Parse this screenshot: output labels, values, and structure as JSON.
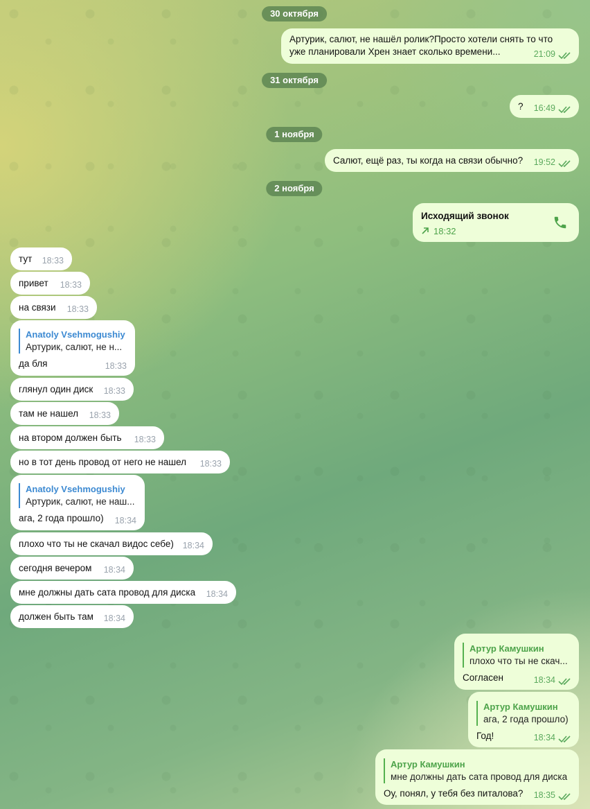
{
  "colors": {
    "incoming_bubble": "#ffffff",
    "outgoing_bubble": "#eefed9",
    "accent_green": "#4da34a",
    "reply_blue": "#3d8ad2",
    "date_pill": "#5c8452"
  },
  "dates": [
    "30 октября",
    "31 октября",
    "1 ноября",
    "2 ноября"
  ],
  "out_messages": [
    {
      "line1": "Артурик, салют, не нашёл ролик?Просто хотели снять то что",
      "line2": "уже планировали Хрен знает сколько времени...",
      "time": "21:09"
    },
    {
      "text": "?",
      "time": "16:49"
    },
    {
      "text": "Салют, ещё раз, ты когда на связи обычно?",
      "time": "19:52"
    }
  ],
  "call": {
    "title": "Исходящий звонок",
    "time": "18:32",
    "icon": "phone-icon",
    "arrow": "outgoing-arrow-icon"
  },
  "in_messages": [
    {
      "text": "тут",
      "time": "18:33"
    },
    {
      "text": "привет",
      "time": "18:33"
    },
    {
      "text": "на связи",
      "time": "18:33"
    },
    {
      "reply_name": "Anatoly Vsehmogushiy",
      "reply_text": "Артурик, салют, не н...",
      "text": "да бля",
      "time": "18:33"
    },
    {
      "text": "глянул один диск",
      "time": "18:33"
    },
    {
      "text": "там не нашел",
      "time": "18:33"
    },
    {
      "text": "на втором должен быть",
      "time": "18:33"
    },
    {
      "text": "но в тот день провод от него не нашел",
      "time": "18:33"
    },
    {
      "reply_name": "Anatoly Vsehmogushiy",
      "reply_text": "Артурик, салют, не наш...",
      "text": "ага, 2 года прошло)",
      "time": "18:34"
    },
    {
      "text": "плохо что ты не скачал видос себе)",
      "time": "18:34"
    },
    {
      "text": "сегодня вечером",
      "time": "18:34"
    },
    {
      "text": "мне должны дать сата провод для диска",
      "time": "18:34"
    },
    {
      "text": "должен быть там",
      "time": "18:34"
    }
  ],
  "out_replies": [
    {
      "reply_name": "Артур Камушкин",
      "reply_text": "плохо что ты не скач...",
      "text": "Согласен",
      "time": "18:34"
    },
    {
      "reply_name": "Артур Камушкин",
      "reply_text": "ага, 2 года прошло)",
      "text": "Год!",
      "time": "18:34"
    },
    {
      "reply_name": "Артур Камушкин",
      "reply_text": "мне должны дать сата провод для диска",
      "text": "Оу, понял, у тебя без питалова?",
      "time": "18:35"
    }
  ]
}
